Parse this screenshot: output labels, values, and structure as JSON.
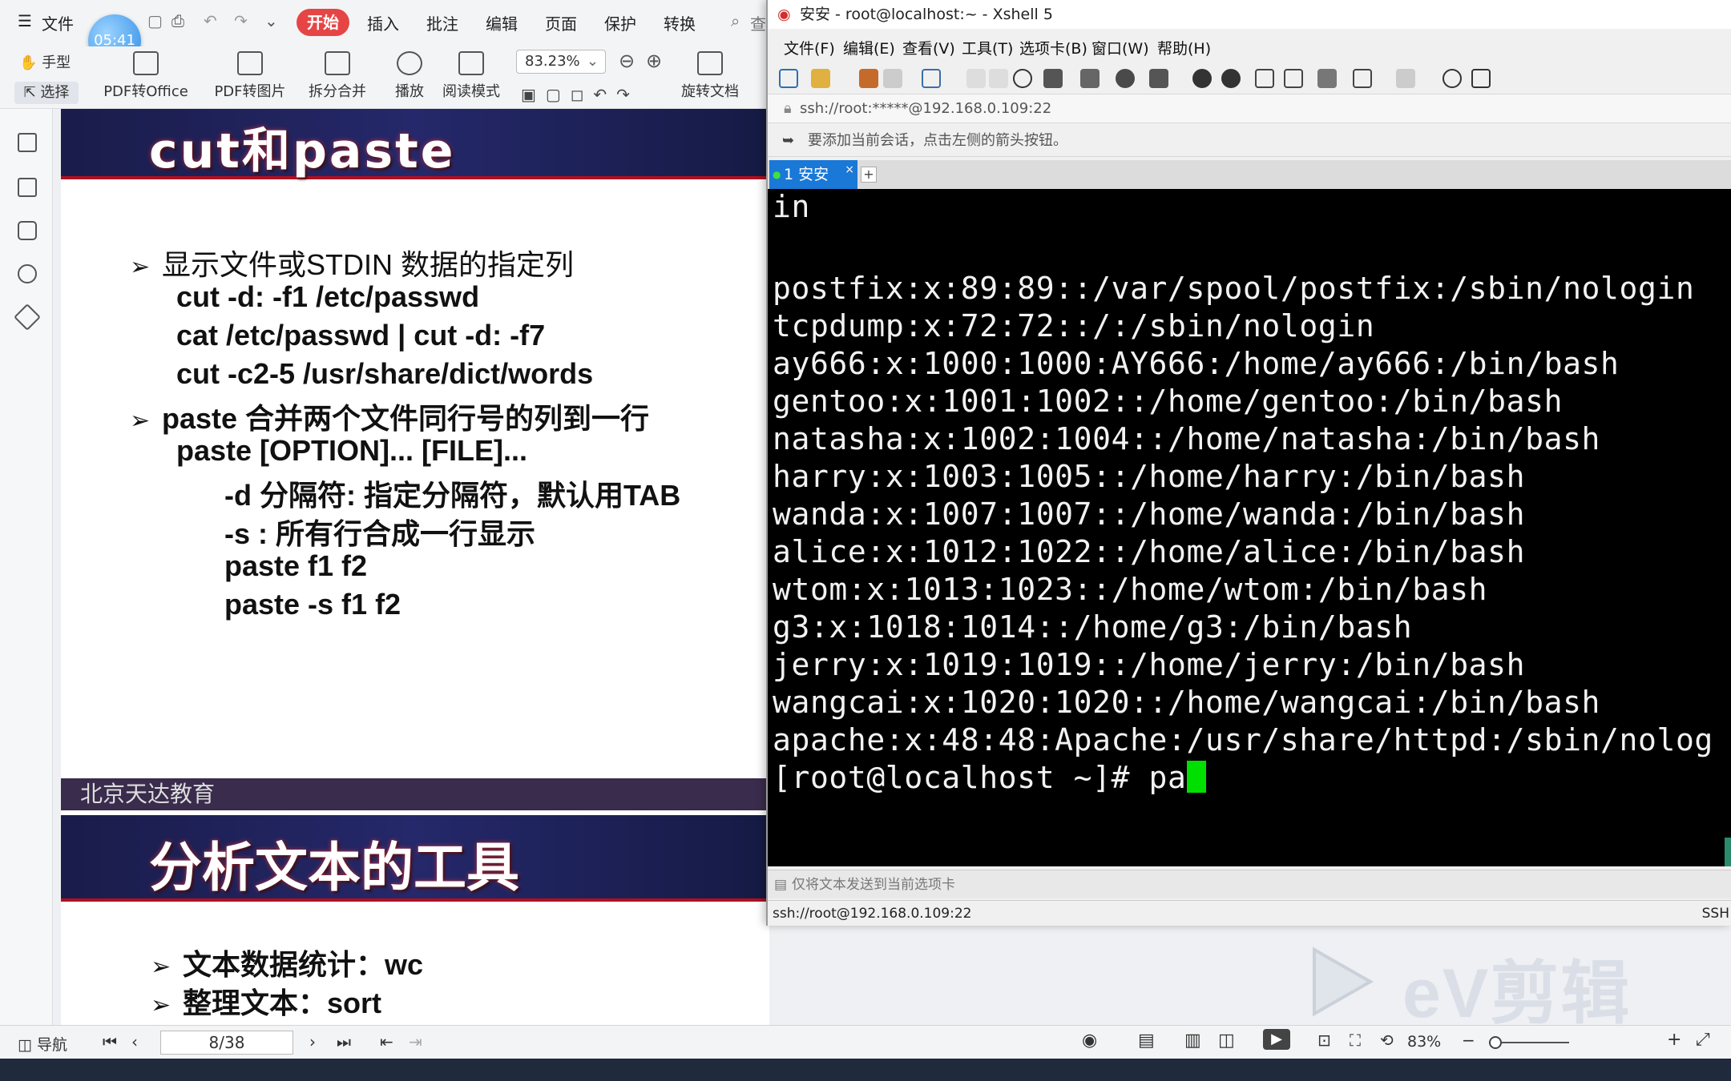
{
  "pdf": {
    "menu": {
      "file": "文件",
      "start": "开始",
      "insert": "插入",
      "annotate": "批注",
      "edit": "编辑",
      "page": "页面",
      "protect": "保护",
      "convert": "转换",
      "search": "查"
    },
    "clock": "05:41",
    "toolbar": {
      "hand": "手型",
      "select": "选择",
      "to_office": "PDF转Office",
      "to_image": "PDF转图片",
      "split_merge": "拆分合并",
      "play": "播放",
      "read_mode": "阅读模式",
      "rotate": "旋转文档",
      "zoom": "83.23%"
    },
    "slide1": {
      "title": "cut和paste",
      "lines": [
        {
          "mark": "➢",
          "text": "显示文件或STDIN 数据的指定列"
        },
        {
          "mark": "",
          "text": "cut -d: -f1 /etc/passwd"
        },
        {
          "mark": "",
          "text": "cat /etc/passwd | cut -d: -f7"
        },
        {
          "mark": "",
          "text": "cut -c2-5 /usr/share/dict/words"
        },
        {
          "mark": "➢",
          "text": "paste  合并两个文件同行号的列到一行"
        },
        {
          "mark": "",
          "text": "paste [OPTION]... [FILE]..."
        },
        {
          "mark": "",
          "text": "-d  分隔符: 指定分隔符，默认用TAB"
        },
        {
          "mark": "",
          "text": "-s :  所有行合成一行显示"
        },
        {
          "mark": "",
          "text": "paste f1 f2"
        },
        {
          "mark": "",
          "text": "paste -s f1 f2"
        }
      ],
      "org": "北京天达教育"
    },
    "slide2": {
      "title": "分析文本的工具",
      "lines": [
        {
          "mark": "➢",
          "text": "文本数据统计：wc"
        },
        {
          "mark": "➢",
          "text": "整理文本：sort"
        }
      ]
    },
    "status": {
      "nav": "导航",
      "page": "8/38",
      "zoom": "83%"
    }
  },
  "xshell": {
    "title": "安安 - root@localhost:~ - Xshell 5",
    "menu": [
      "文件(F)",
      "编辑(E)",
      "查看(V)",
      "工具(T)",
      "选项卡(B)",
      "窗口(W)",
      "帮助(H)"
    ],
    "address": "ssh://root:*****@192.168.0.109:22",
    "hint": "要添加当前会话，点击左侧的箭头按钮。",
    "tab": "1 安安",
    "terminal_lines": [
      "in",
      "",
      "",
      "postfix:x:89:89::/var/spool/postfix:/sbin/nologin",
      "tcpdump:x:72:72::/:/sbin/nologin",
      "ay666:x:1000:1000:AY666:/home/ay666:/bin/bash",
      "gentoo:x:1001:1002::/home/gentoo:/bin/bash",
      "natasha:x:1002:1004::/home/natasha:/bin/bash",
      "harry:x:1003:1005::/home/harry:/bin/bash",
      "wanda:x:1007:1007::/home/wanda:/bin/bash",
      "alice:x:1012:1022::/home/alice:/bin/bash",
      "wtom:x:1013:1023::/home/wtom:/bin/bash",
      "g3:x:1018:1014::/home/g3:/bin/bash",
      "jerry:x:1019:1019::/home/jerry:/bin/bash",
      "wangcai:x:1020:1020::/home/wangcai:/bin/bash",
      "apache:x:48:48:Apache:/usr/share/httpd:/sbin/nolog"
    ],
    "prompt": "[root@localhost ~]# pa",
    "send_hint": "仅将文本发送到当前选项卡",
    "status": "ssh://root@192.168.0.109:22",
    "status_right": "SSH"
  },
  "watermark": "eV剪辑"
}
